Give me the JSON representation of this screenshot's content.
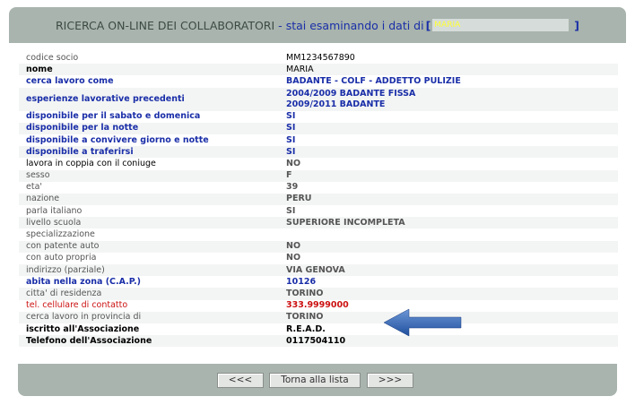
{
  "header": {
    "title": "RICERCA ON-LINE DEI COLLABORATORI",
    "separator": "-",
    "subtitle": "stai esaminando i dati di",
    "bracket_open": "[",
    "name": "MARIA",
    "bracket_close": "]"
  },
  "rows": [
    {
      "label": "codice socio",
      "value": "MM1234567890"
    },
    {
      "label": "nome",
      "value": "MARIA"
    },
    {
      "label": "cerca lavoro come",
      "value": "BADANTE - COLF - ADDETTO PULIZIE"
    },
    {
      "label": "esperienze lavorative precedenti",
      "value": "2004/2009 BADANTE FISSA",
      "value2": "2009/2011 BADANTE"
    },
    {
      "label": "disponibile per il sabato e domenica",
      "value": "SI"
    },
    {
      "label": "disponibile per la notte",
      "value": "SI"
    },
    {
      "label": "disponibile a convivere giorno e notte",
      "value": "SI"
    },
    {
      "label": "disponibile a traferirsi",
      "value": "SI"
    },
    {
      "label": "lavora in coppia con il coniuge",
      "value": "NO"
    },
    {
      "label": "sesso",
      "value": "F"
    },
    {
      "label": "eta'",
      "value": "39"
    },
    {
      "label": "nazione",
      "value": "PERU"
    },
    {
      "label": "parla italiano",
      "value": "SI"
    },
    {
      "label": "livello scuola",
      "value": "SUPERIORE INCOMPLETA"
    },
    {
      "label": "specializzazione",
      "value": ""
    },
    {
      "label": "con patente auto",
      "value": "NO"
    },
    {
      "label": "con auto propria",
      "value": "NO"
    },
    {
      "label": "indirizzo (parziale)",
      "value": "VIA GENOVA"
    },
    {
      "label": "abita nella zona (C.A.P.)",
      "value": "10126"
    },
    {
      "label": "citta' di residenza",
      "value": "TORINO"
    },
    {
      "label": "tel. cellulare di contatto",
      "value": "333.9999000"
    },
    {
      "label": "cerca lavoro in provincia di",
      "value": "TORINO"
    },
    {
      "label": "iscritto all'Associazione",
      "value": "R.E.A.D."
    },
    {
      "label": "Telefono dell'Associazione",
      "value": "0117504110"
    }
  ],
  "footer": {
    "prev_label": "<<<",
    "back_label": "Torna alla lista",
    "next_label": ">>>"
  },
  "colors": {
    "header_bg": "#a8b4ad",
    "label_blue": "#1a2ea8",
    "label_red": "#cc1111",
    "arrow_blue": "#2f63b5"
  },
  "icons": {
    "pointer": "arrow-left-icon"
  }
}
